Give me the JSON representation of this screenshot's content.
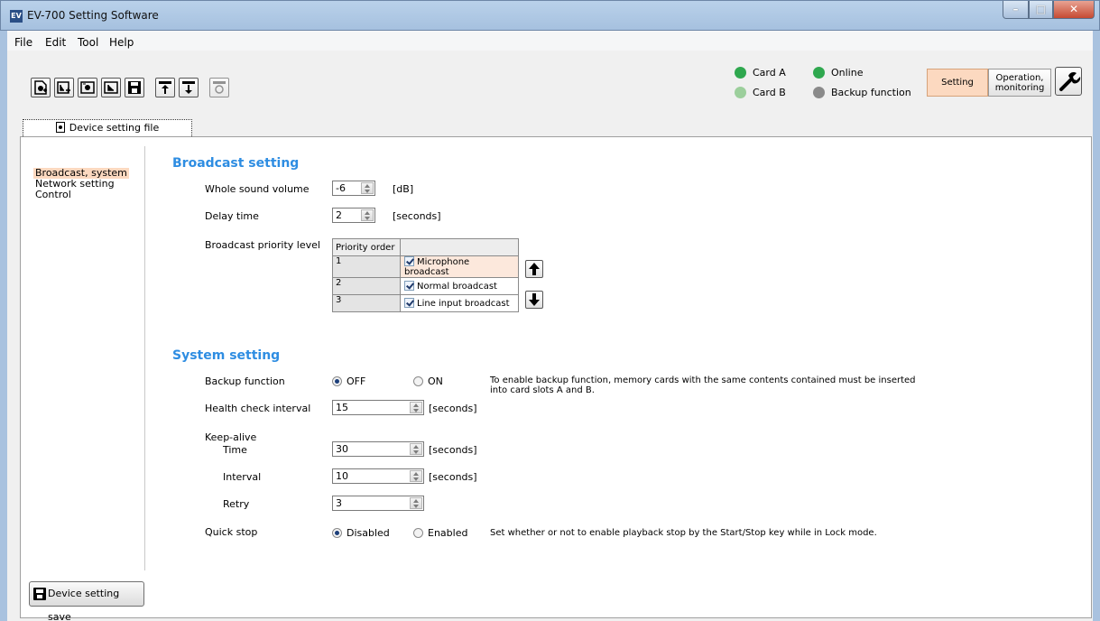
{
  "window": {
    "title": "EV-700 Setting Software",
    "app_icon_text": "EV"
  },
  "menu": [
    "File",
    "Edit",
    "Tool",
    "Help"
  ],
  "status": {
    "card_a": "Card A",
    "card_b": "Card B",
    "online": "Online",
    "backup": "Backup function",
    "colors": {
      "ok": "#2fa84f",
      "disabled": "#9ccf9c",
      "off": "#8a8a8a"
    }
  },
  "modes": {
    "setting": "Setting",
    "operation_line1": "Operation,",
    "operation_line2": "monitoring"
  },
  "tab": {
    "label": "Device setting file"
  },
  "nav": {
    "items": [
      "Broadcast, system",
      "Network setting",
      "Control"
    ]
  },
  "save_button": "Device setting save",
  "broadcast": {
    "title": "Broadcast setting",
    "volume": {
      "label": "Whole sound volume",
      "value": "-6",
      "unit": "[dB]"
    },
    "delay": {
      "label": "Delay time",
      "value": "2",
      "unit": "[seconds]"
    },
    "priority": {
      "label": "Broadcast priority level",
      "header": "Priority order",
      "rows": [
        {
          "num": "1",
          "name": "Microphone broadcast",
          "checked": true,
          "selected": true
        },
        {
          "num": "2",
          "name": "Normal broadcast",
          "checked": true,
          "selected": false
        },
        {
          "num": "3",
          "name": "Line input broadcast",
          "checked": true,
          "selected": false
        }
      ]
    }
  },
  "system": {
    "title": "System setting",
    "backup": {
      "label": "Backup function",
      "off": "OFF",
      "on": "ON",
      "selected": "OFF",
      "note_line1": "To enable backup function, memory cards with the same contents contained must be inserted",
      "note_line2": "into card slots A and B."
    },
    "health": {
      "label": "Health check interval",
      "value": "15",
      "unit": "[seconds]"
    },
    "keepalive": {
      "label": "Keep-alive",
      "time": {
        "label": "Time",
        "value": "30",
        "unit": "[seconds]"
      },
      "interval": {
        "label": "Interval",
        "value": "10",
        "unit": "[seconds]"
      },
      "retry": {
        "label": "Retry",
        "value": "3"
      }
    },
    "quickstop": {
      "label": "Quick stop",
      "disabled": "Disabled",
      "enabled": "Enabled",
      "selected": "Disabled",
      "note": "Set whether or not to enable playback stop by the Start/Stop key while in Lock mode."
    }
  },
  "accent_colors": {
    "section_title": "#2e8de2",
    "selection": "#fcd9c0",
    "title_bar": "#b9d1ea"
  }
}
